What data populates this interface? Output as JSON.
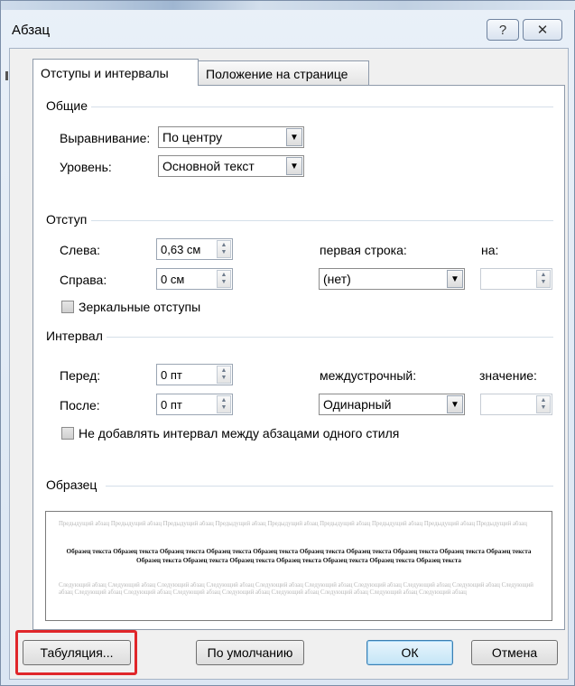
{
  "window": {
    "title": "Абзац",
    "help_glyph": "?",
    "close_glyph": "✕"
  },
  "tabs": [
    {
      "label": "Отступы и интервалы",
      "active": true
    },
    {
      "label": "Положение на странице",
      "active": false
    }
  ],
  "general": {
    "title": "Общие",
    "alignment_label": "Выравнивание:",
    "alignment_value": "По центру",
    "level_label": "Уровень:",
    "level_value": "Основной текст"
  },
  "indent": {
    "title": "Отступ",
    "left_label": "Слева:",
    "left_value": "0,63 см",
    "right_label": "Справа:",
    "right_value": "0 см",
    "first_line_label": "первая строка:",
    "first_line_value": "(нет)",
    "by_label": "на:",
    "by_value": "",
    "mirror_label": "Зеркальные отступы",
    "mirror_checked": false
  },
  "spacing": {
    "title": "Интервал",
    "before_label": "Перед:",
    "before_value": "0 пт",
    "after_label": "После:",
    "after_value": "0 пт",
    "line_label": "междустрочный:",
    "line_value": "Одинарный",
    "at_label": "значение:",
    "at_value": "",
    "dont_add_label": "Не добавлять интервал между абзацами одного стиля",
    "dont_add_checked": false
  },
  "preview": {
    "title": "Образец",
    "previous_text": "Предыдущий абзац Предыдущий абзац Предыдущий абзац Предыдущий абзац Предыдущий абзац Предыдущий абзац Предыдущий абзац Предыдущий абзац Предыдущий абзац",
    "current_text": "Образец текста Образец текста Образец текста Образец текста Образец текста Образец текста Образец текста Образец текста Образец текста Образец текста Образец текста Образец текста Образец текста Образец текста Образец текста Образец текста Образец текста",
    "next_text": "Следующий абзац Следующий абзац Следующий абзац Следующий абзац Следующий абзац Следующий абзац Следующий абзац Следующий абзац Следующий абзац Следующий абзац Следующий абзац Следующий абзац Следующий абзац Следующий абзац Следующий абзац Следующий абзац Следующий абзац Следующий абзац"
  },
  "buttons": {
    "tabs_label": "Табуляция...",
    "default_label": "По умолчанию",
    "ok_label": "ОК",
    "cancel_label": "Отмена"
  },
  "colors": {
    "highlight": "#e0262a"
  }
}
